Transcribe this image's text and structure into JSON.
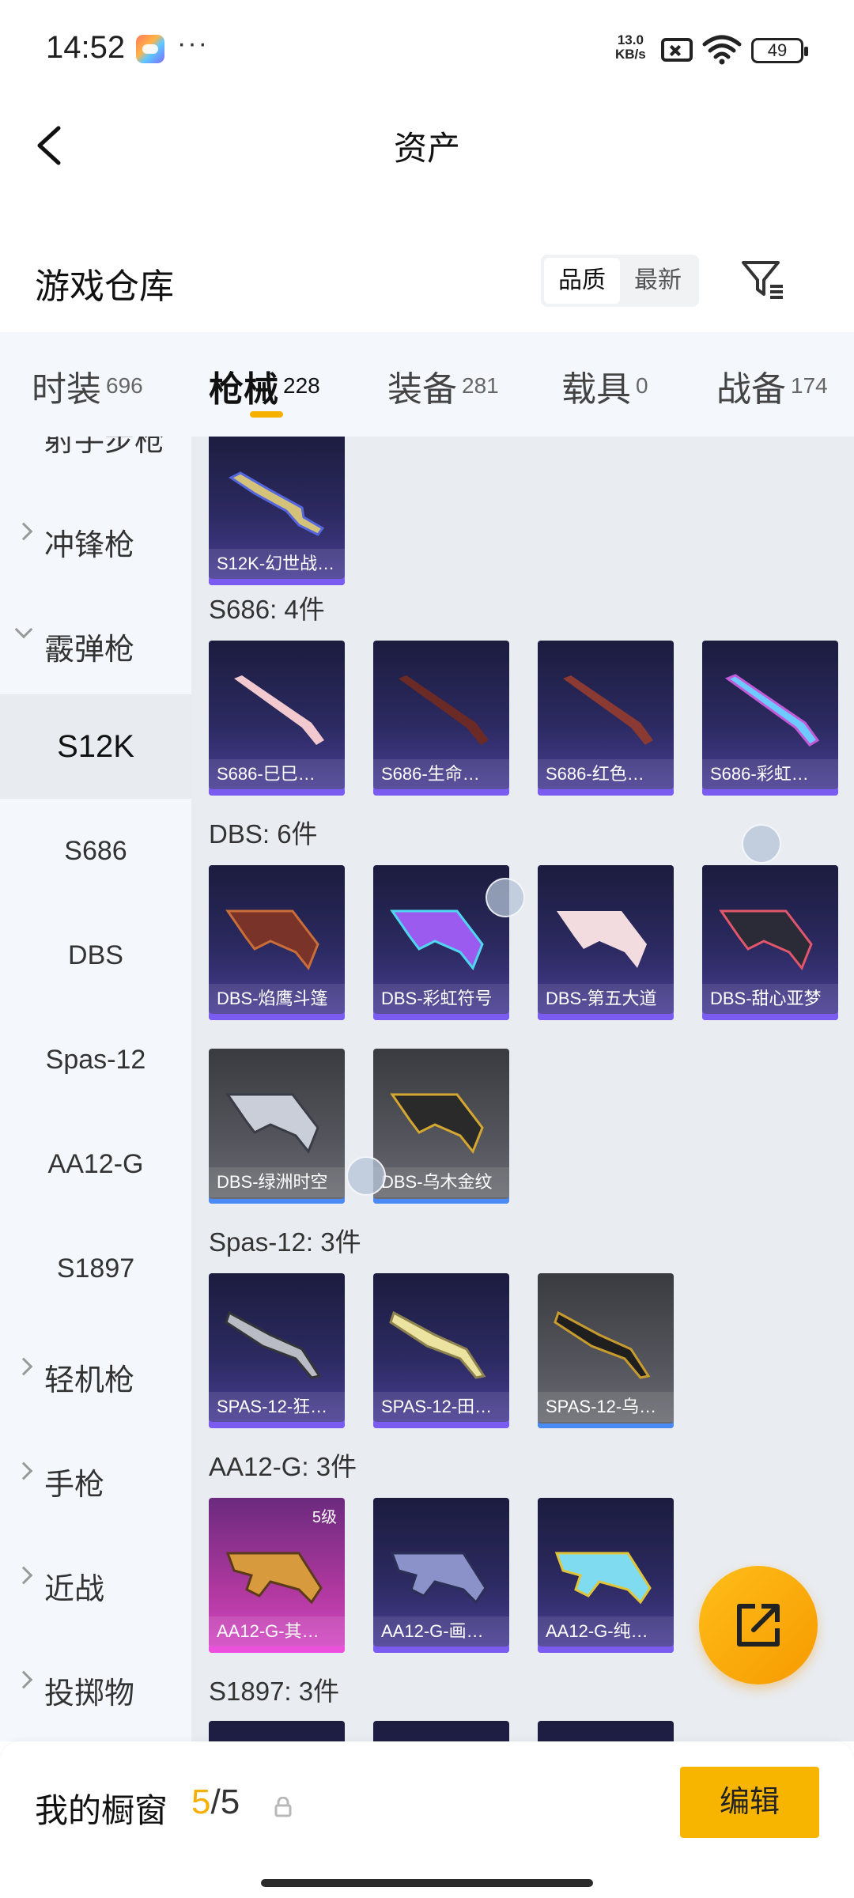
{
  "status": {
    "time": "14:52",
    "net_speed_value": "13.0",
    "net_speed_unit": "KB/s",
    "battery": "49"
  },
  "header": {
    "title": "资产"
  },
  "warehouse": {
    "title": "游戏仓库",
    "sort_options": [
      "品质",
      "最新"
    ],
    "sort_active": "品质"
  },
  "tabs": [
    {
      "label": "时装",
      "count": "696"
    },
    {
      "label": "枪械",
      "count": "228"
    },
    {
      "label": "装备",
      "count": "281"
    },
    {
      "label": "载具",
      "count": "0"
    },
    {
      "label": "战备",
      "count": "174"
    }
  ],
  "active_tab": "枪械",
  "sidebar": {
    "categories": {
      "rifle": "射手步枪",
      "smg": "冲锋枪",
      "shotgun": "霰弹枪",
      "lmg": "轻机枪",
      "pistol": "手枪",
      "melee": "近战",
      "throwable": "投掷物"
    },
    "shotgun_subs": [
      "S12K",
      "S686",
      "DBS",
      "Spas-12",
      "AA12-G",
      "S1897"
    ],
    "active_sub": "S12K"
  },
  "groups": {
    "s12k": {
      "items": [
        {
          "label": "S12K-幻世战…",
          "style": "purple"
        }
      ]
    },
    "s686": {
      "title": "S686: 4件",
      "items": [
        {
          "label": "S686-巳巳…",
          "style": "purple"
        },
        {
          "label": "S686-生命…",
          "style": "purple"
        },
        {
          "label": "S686-红色…",
          "style": "purple"
        },
        {
          "label": "S686-彩虹…",
          "style": "purple"
        }
      ]
    },
    "dbs": {
      "title": "DBS: 6件",
      "items": [
        {
          "label": "DBS-焰鹰斗篷",
          "style": "purple"
        },
        {
          "label": "DBS-彩虹符号",
          "style": "purple"
        },
        {
          "label": "DBS-第五大道",
          "style": "purple"
        },
        {
          "label": "DBS-甜心亚梦",
          "style": "purple"
        },
        {
          "label": "DBS-绿洲时空",
          "style": "gray"
        },
        {
          "label": "DBS-乌木金纹",
          "style": "gray"
        }
      ]
    },
    "spas12": {
      "title": "Spas-12: 3件",
      "items": [
        {
          "label": "SPAS-12-狂…",
          "style": "purple"
        },
        {
          "label": "SPAS-12-田…",
          "style": "purple"
        },
        {
          "label": "SPAS-12-乌…",
          "style": "gray"
        }
      ]
    },
    "aa12g": {
      "title": "AA12-G: 3件",
      "items": [
        {
          "label": "AA12-G-其…",
          "style": "pink",
          "badge": "5级"
        },
        {
          "label": "AA12-G-画…",
          "style": "purple"
        },
        {
          "label": "AA12-G-纯…",
          "style": "purple"
        }
      ]
    },
    "s1897": {
      "title": "S1897: 3件"
    }
  },
  "bottombar": {
    "showcase_label": "我的橱窗",
    "showcase_current": "5",
    "showcase_total": "/5",
    "edit_label": "编辑"
  },
  "colors": {
    "accent": "#f6b100",
    "card_purple": "#2c2a61",
    "card_gray": "#55565d",
    "card_pink": "#b0389f"
  },
  "icons": [
    "back-arrow-icon",
    "filter-icon",
    "lock-icon",
    "share-icon"
  ]
}
